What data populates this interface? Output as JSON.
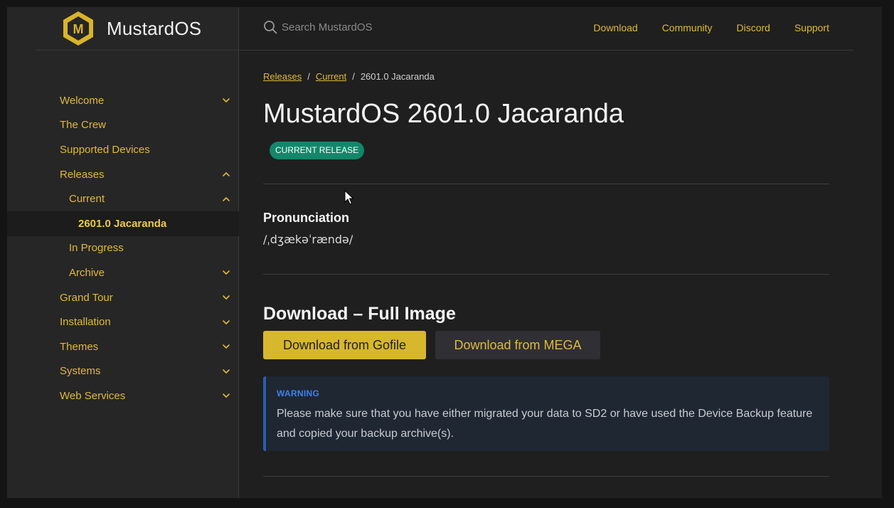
{
  "site": {
    "name": "MustardOS",
    "logo_letter": "M"
  },
  "search": {
    "placeholder": "Search MustardOS",
    "icon": "search-icon"
  },
  "top_nav": [
    "Download",
    "Community",
    "Discord",
    "Support"
  ],
  "sidebar": {
    "items": [
      {
        "label": "Welcome",
        "level": 1,
        "chevron": "down"
      },
      {
        "label": "The Crew",
        "level": 1,
        "chevron": ""
      },
      {
        "label": "Supported Devices",
        "level": 1,
        "chevron": ""
      },
      {
        "label": "Releases",
        "level": 1,
        "chevron": "up"
      },
      {
        "label": "Current",
        "level": 2,
        "chevron": "up"
      },
      {
        "label": "2601.0 Jacaranda",
        "level": 3,
        "chevron": "",
        "active": true
      },
      {
        "label": "In Progress",
        "level": 2,
        "chevron": ""
      },
      {
        "label": "Archive",
        "level": 2,
        "chevron": "down"
      },
      {
        "label": "Grand Tour",
        "level": 1,
        "chevron": "down"
      },
      {
        "label": "Installation",
        "level": 1,
        "chevron": "down"
      },
      {
        "label": "Themes",
        "level": 1,
        "chevron": "down"
      },
      {
        "label": "Systems",
        "level": 1,
        "chevron": "down"
      },
      {
        "label": "Web Services",
        "level": 1,
        "chevron": "down"
      }
    ]
  },
  "breadcrumb": {
    "links": [
      "Releases",
      "Current"
    ],
    "current": "2601.0 Jacaranda",
    "separator": "/"
  },
  "page": {
    "title": "MustardOS 2601.0 Jacaranda",
    "badge": "CURRENT RELEASE",
    "pronunciation_heading": "Pronunciation",
    "pronunciation": "/ˌdʒækəˈrændə/",
    "download_heading": "Download – Full Image",
    "download_gofile": "Download from Gofile",
    "download_mega": "Download from MEGA",
    "warning_title": "WARNING",
    "warning_text": "Please make sure that you have either migrated your data to SD2 or have used the Device Backup feature and copied your backup archive(s)."
  },
  "colors": {
    "accent": "#e0b93a",
    "badge": "#12876a",
    "warning_border": "#2a5db0",
    "warning_title": "#3b82f0"
  }
}
